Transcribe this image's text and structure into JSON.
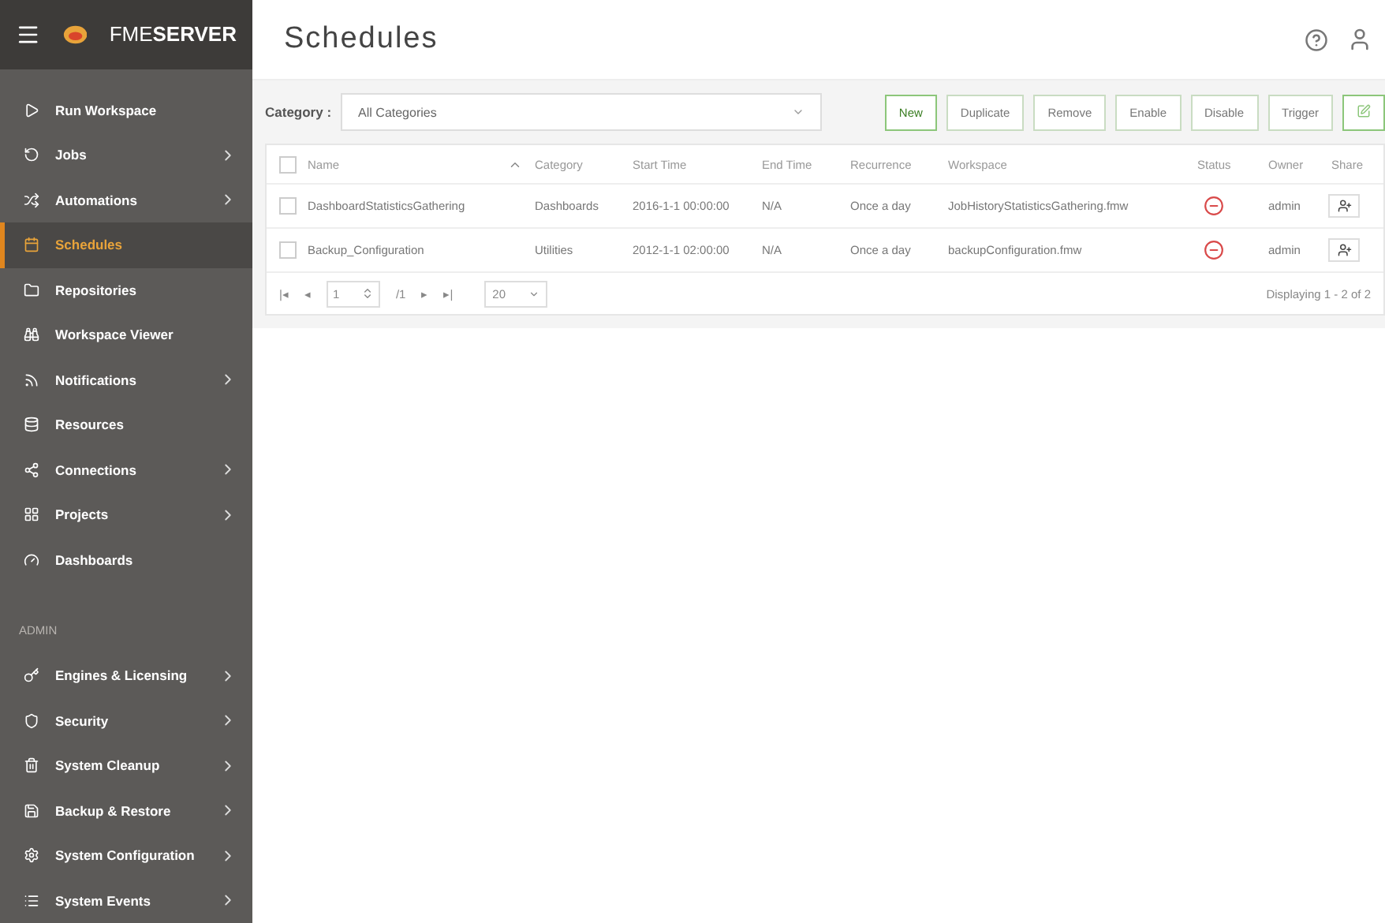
{
  "brand": {
    "light": "FME",
    "bold": "SERVER"
  },
  "sidebar": {
    "items": [
      {
        "label": "Run Workspace",
        "expandable": false,
        "selected": false
      },
      {
        "label": "Jobs",
        "expandable": true,
        "selected": false
      },
      {
        "label": "Automations",
        "expandable": true,
        "selected": false
      },
      {
        "label": "Schedules",
        "expandable": false,
        "selected": true
      },
      {
        "label": "Repositories",
        "expandable": false,
        "selected": false
      },
      {
        "label": "Workspace Viewer",
        "expandable": false,
        "selected": false
      },
      {
        "label": "Notifications",
        "expandable": true,
        "selected": false
      },
      {
        "label": "Resources",
        "expandable": false,
        "selected": false
      },
      {
        "label": "Connections",
        "expandable": true,
        "selected": false
      },
      {
        "label": "Projects",
        "expandable": true,
        "selected": false
      },
      {
        "label": "Dashboards",
        "expandable": false,
        "selected": false
      }
    ],
    "admin_heading": "ADMIN",
    "admin_items": [
      {
        "label": "Engines & Licensing",
        "expandable": true,
        "selected": false
      },
      {
        "label": "Security",
        "expandable": true,
        "selected": false
      },
      {
        "label": "System Cleanup",
        "expandable": true,
        "selected": false
      },
      {
        "label": "Backup & Restore",
        "expandable": true,
        "selected": false
      },
      {
        "label": "System Configuration",
        "expandable": true,
        "selected": false
      },
      {
        "label": "System Events",
        "expandable": true,
        "selected": false
      }
    ]
  },
  "page_title": "Schedules",
  "filter": {
    "label": "Category :",
    "value": "All Categories"
  },
  "buttons": [
    {
      "label": "New",
      "primary": true
    },
    {
      "label": "Duplicate",
      "primary": false
    },
    {
      "label": "Remove",
      "primary": false
    },
    {
      "label": "Enable",
      "primary": false
    },
    {
      "label": "Disable",
      "primary": false
    },
    {
      "label": "Trigger",
      "primary": false
    }
  ],
  "table": {
    "all_checked": false,
    "columns": [
      "Name",
      "Category",
      "Start Time",
      "End Time",
      "Recurrence",
      "Workspace",
      "Status",
      "Owner",
      "Share"
    ],
    "rows": [
      {
        "checked": false,
        "name": "DashboardStatisticsGathering",
        "category": "Dashboards",
        "start": "2016-1-1 00:00:00",
        "end": "N/A",
        "recurrence": "Once a day",
        "workspace": "JobHistoryStatisticsGathering.fmw",
        "enabled": false,
        "owner": "admin"
      },
      {
        "checked": false,
        "name": "Backup_Configuration",
        "category": "Utilities",
        "start": "2012-1-1 02:00:00",
        "end": "N/A",
        "recurrence": "Once a day",
        "workspace": "backupConfiguration.fmw",
        "enabled": false,
        "owner": "admin"
      }
    ]
  },
  "pager": {
    "first": "|◂",
    "prev": "◂",
    "page": "1",
    "total": "/1",
    "next": "▸",
    "last": "▸|",
    "page_size": "20",
    "summary": "Displaying 1 - 2 of 2"
  }
}
